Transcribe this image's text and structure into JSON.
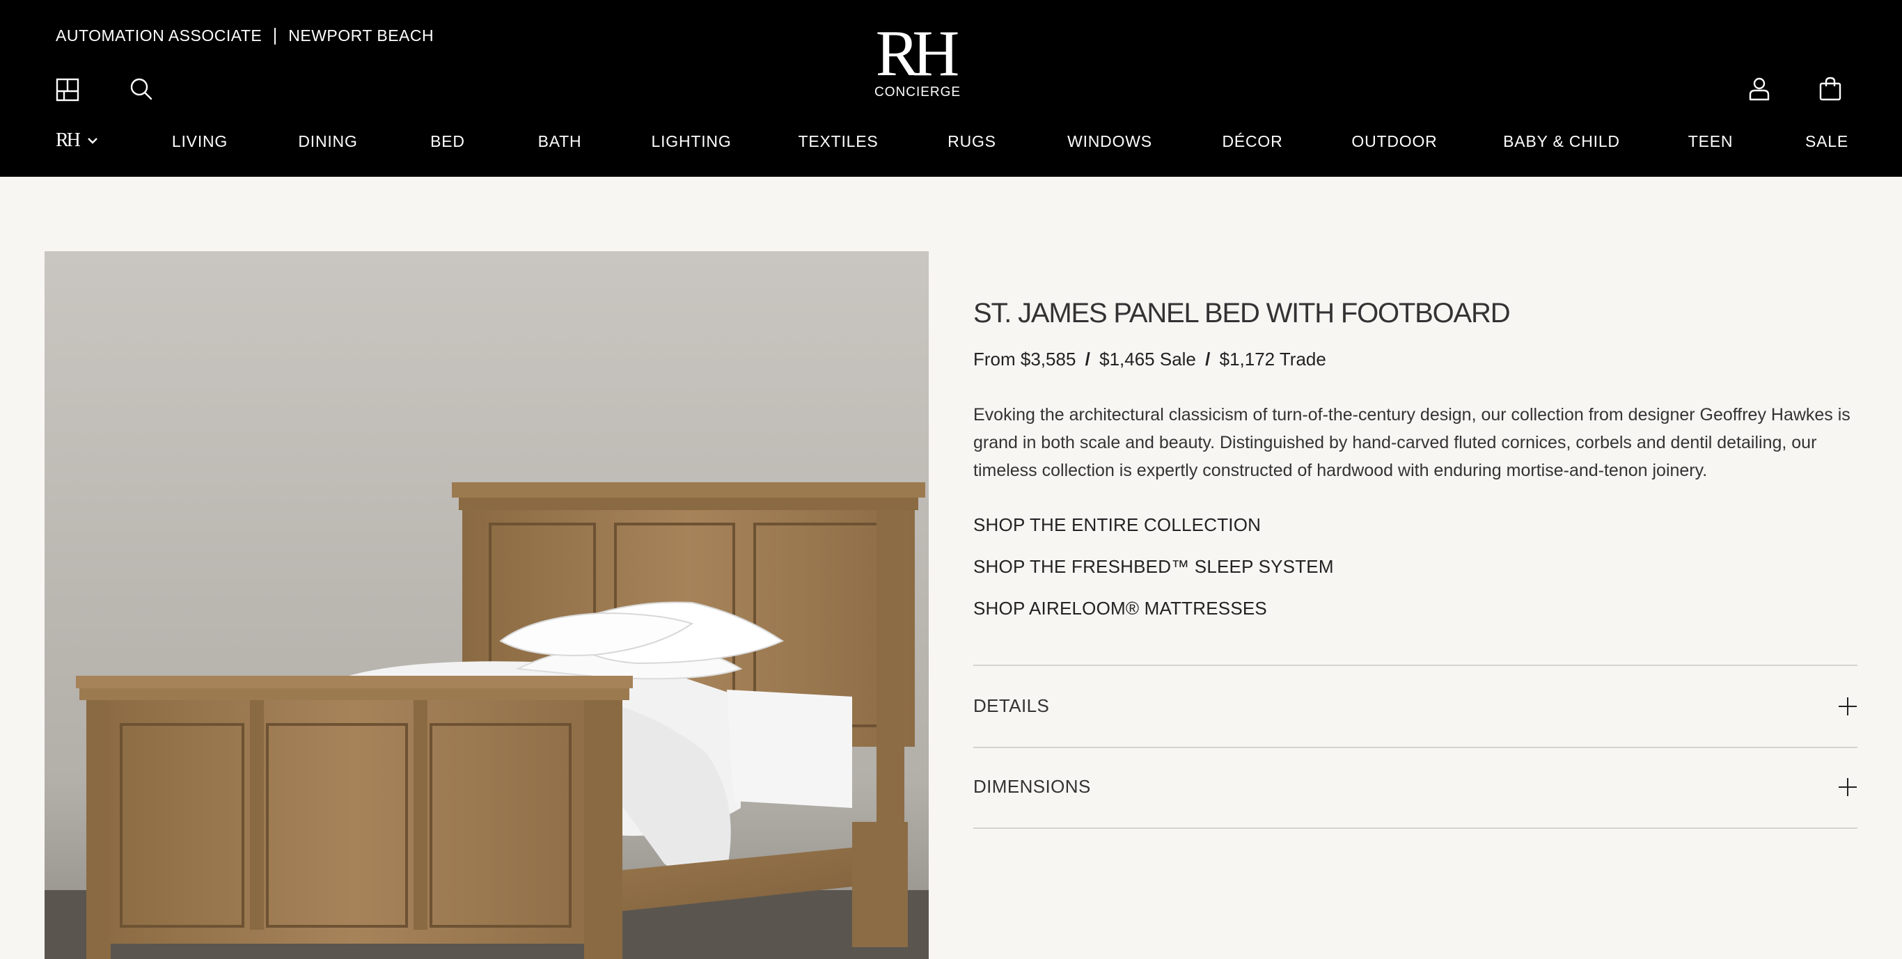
{
  "header": {
    "associate": "AUTOMATION ASSOCIATE",
    "location": "NEWPORT BEACH",
    "logo_mark": "RH",
    "logo_sub": "CONCIERGE",
    "brand_mini": "RH",
    "icons": {
      "gallery": "gallery-icon",
      "search": "search-icon",
      "account": "account-icon",
      "bag": "shopping-bag-icon",
      "chevron": "chevron-down-icon"
    }
  },
  "nav": {
    "items": [
      "LIVING",
      "DINING",
      "BED",
      "BATH",
      "LIGHTING",
      "TEXTILES",
      "RUGS",
      "WINDOWS",
      "DÉCOR",
      "OUTDOOR",
      "BABY & CHILD",
      "TEEN",
      "SALE"
    ]
  },
  "product": {
    "title": "ST. JAMES PANEL BED WITH FOOTBOARD",
    "price_from": "From $3,585",
    "price_sale": "$1,465 Sale",
    "price_trade": "$1,172 Trade",
    "description": "Evoking the architectural classicism of turn-of-the-century design, our collection from designer Geoffrey Hawkes is grand in both scale and beauty. Distinguished by hand-carved fluted cornices, corbels and dentil detailing, our timeless collection is expertly constructed of hardwood with enduring mortise-and-tenon joinery.",
    "links": [
      "SHOP THE ENTIRE COLLECTION",
      "SHOP THE FRESHBED™ SLEEP SYSTEM",
      "SHOP AIRELOOM® MATTRESSES"
    ],
    "accordions": [
      "DETAILS",
      "DIMENSIONS"
    ]
  },
  "colors": {
    "header_bg": "#000000",
    "page_bg": "#f7f6f3",
    "wood": "#9c7a4f"
  }
}
